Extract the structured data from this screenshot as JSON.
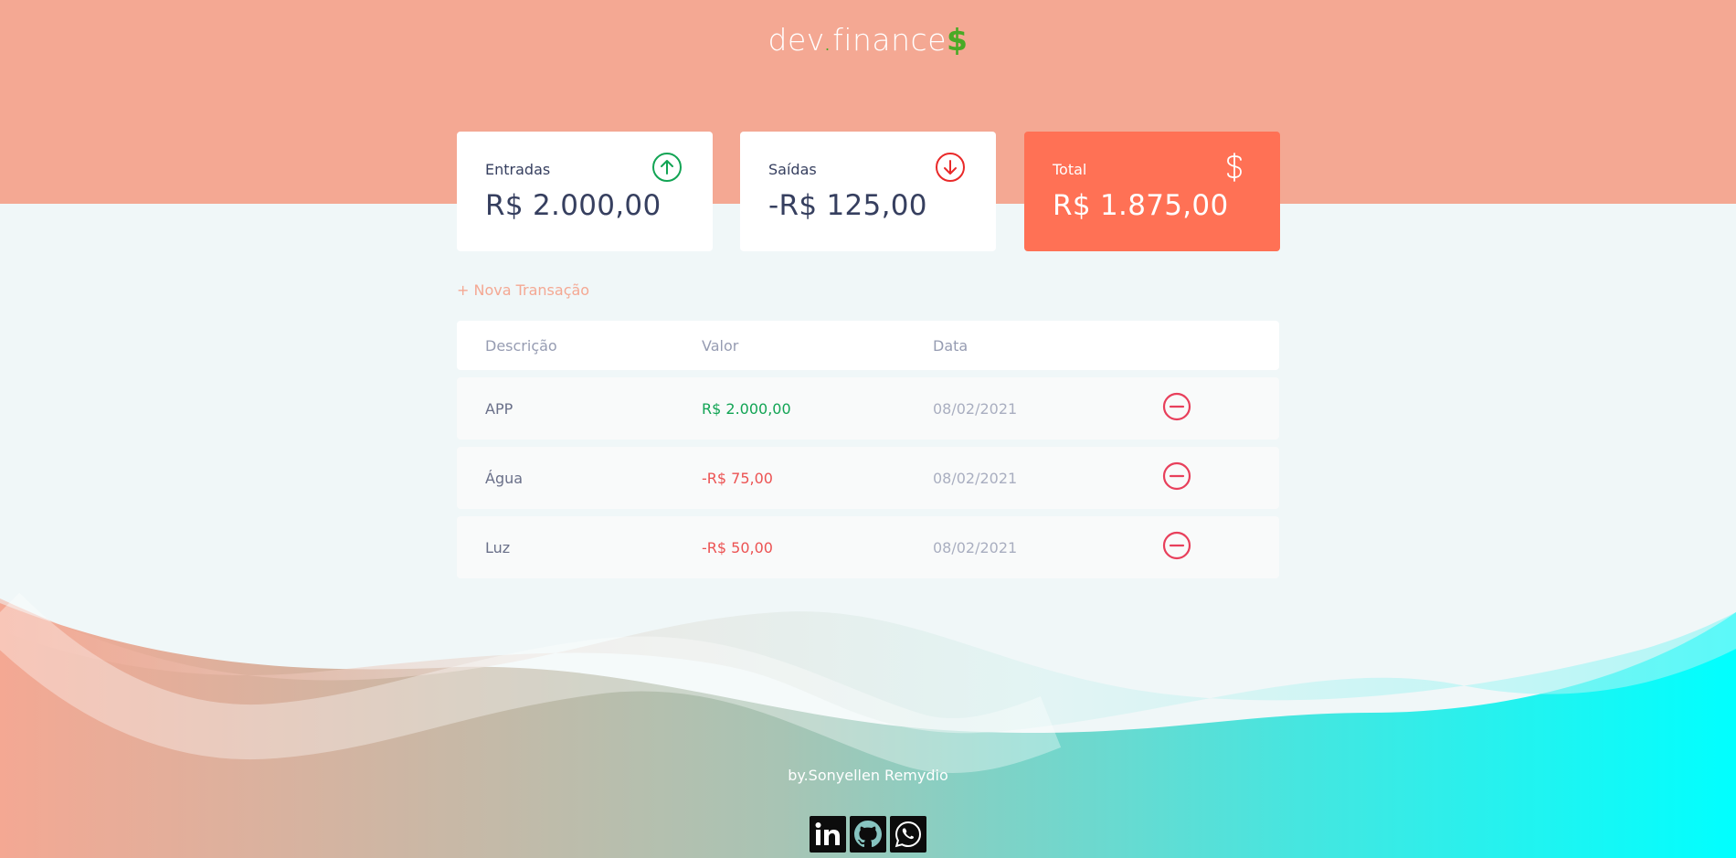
{
  "app": {
    "logo_main": "dev",
    "logo_dot": ".",
    "logo_rest": "finance",
    "logo_dollar": "$"
  },
  "cards": [
    {
      "label": "Entradas",
      "value": "R$ 2.000,00",
      "icon": "arrow-up-circle-icon"
    },
    {
      "label": "Saídas",
      "value": "-R$ 125,00",
      "icon": "arrow-down-circle-icon"
    },
    {
      "label": "Total",
      "value": "R$ 1.875,00",
      "icon": "dollar-icon"
    }
  ],
  "actions": {
    "new_transaction": "+ Nova Transação"
  },
  "table": {
    "headers": [
      "Descrição",
      "Valor",
      "Data"
    ],
    "rows": [
      {
        "description": "APP",
        "amount": "R$ 2.000,00",
        "type": "income",
        "date": "08/02/2021"
      },
      {
        "description": "Água",
        "amount": "-R$ 75,00",
        "type": "expense",
        "date": "08/02/2021"
      },
      {
        "description": "Luz",
        "amount": "-R$ 50,00",
        "type": "expense",
        "date": "08/02/2021"
      }
    ]
  },
  "footer": {
    "credit": "by.Sonyellen Remydio",
    "socials": [
      "linkedin-icon",
      "github-icon",
      "whatsapp-icon"
    ]
  },
  "colors": {
    "header": "#f4a893",
    "total_card": "#ff7155",
    "income": "#12a454",
    "expense": "#e92929",
    "accent_green": "#49aa26"
  }
}
